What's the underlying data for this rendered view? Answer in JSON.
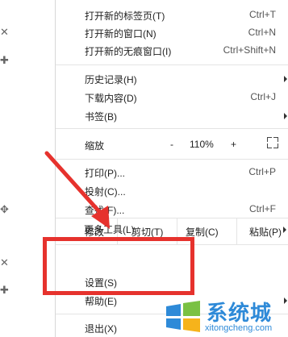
{
  "menu": {
    "items": [
      {
        "label": "打开新的标签页(T)",
        "shortcut": "Ctrl+T"
      },
      {
        "label": "打开新的窗口(N)",
        "shortcut": "Ctrl+N"
      },
      {
        "label": "打开新的无痕窗口(I)",
        "shortcut": "Ctrl+Shift+N"
      },
      {
        "label": "历史记录(H)",
        "shortcut": ""
      },
      {
        "label": "下载内容(D)",
        "shortcut": "Ctrl+J"
      },
      {
        "label": "书签(B)",
        "shortcut": ""
      },
      {
        "label": "打印(P)...",
        "shortcut": "Ctrl+P"
      },
      {
        "label": "投射(C)...",
        "shortcut": ""
      },
      {
        "label": "查找(F)...",
        "shortcut": "Ctrl+F"
      },
      {
        "label": "更多工具(L)",
        "shortcut": ""
      },
      {
        "label": "设置(S)",
        "shortcut": ""
      },
      {
        "label": "帮助(E)",
        "shortcut": ""
      },
      {
        "label": "退出(X)",
        "shortcut": ""
      }
    ],
    "zoom": {
      "label": "缩放",
      "minus": "-",
      "value": "110%",
      "plus": "+"
    },
    "edit": {
      "label": "修改",
      "cut": "剪切(T)",
      "copy": "复制(C)",
      "paste": "粘贴(P)"
    }
  },
  "watermark": {
    "title": "系统城",
    "subtitle": "xitongcheng.com"
  },
  "colors": {
    "highlight": "#e6322d",
    "watermark": "#2e8ad8"
  },
  "icons": [
    "move-icon",
    "close-icon",
    "plus-icon",
    "fullscreen-icon",
    "submenu-arrow-icon",
    "windows-logo-icon"
  ]
}
